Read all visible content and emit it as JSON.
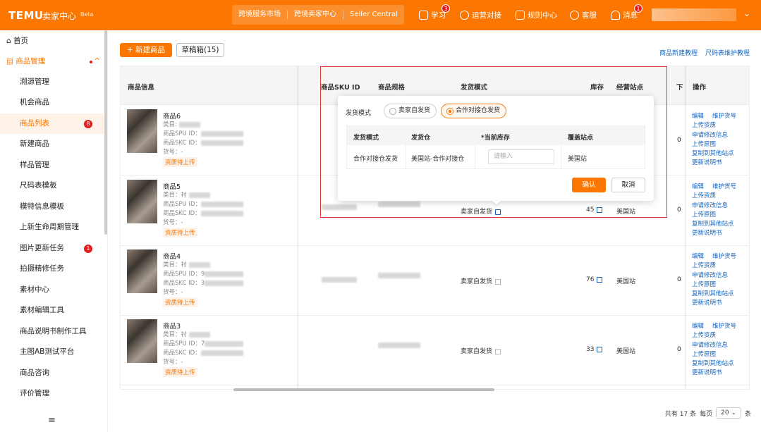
{
  "colors": {
    "brand": "#fb7701",
    "link": "#1565c0",
    "highlight_box": "#e53935",
    "badge": "#e02020"
  },
  "header": {
    "logo": "TEMU",
    "brand_title": "卖家中心",
    "beta": "Beta",
    "nav": [
      "跨境服务市场",
      "跨境卖家中心",
      "Seller Central"
    ],
    "items": [
      {
        "icon": "book-icon",
        "label": "学习",
        "badge": "3"
      },
      {
        "icon": "chat-icon",
        "label": "运营对接"
      },
      {
        "icon": "document-icon",
        "label": "规则中心"
      },
      {
        "icon": "headset-icon",
        "label": "客服"
      },
      {
        "icon": "bell-icon",
        "label": "消息",
        "badge": "1"
      }
    ]
  },
  "sidebar": {
    "items": [
      {
        "label": "首页",
        "icon": "home-icon"
      },
      {
        "label": "商品管理",
        "icon": "box-icon"
      },
      {
        "label": "溯源管理"
      },
      {
        "label": "机会商品"
      },
      {
        "label": "商品列表",
        "badge": "8"
      },
      {
        "label": "新建商品"
      },
      {
        "label": "样品管理"
      },
      {
        "label": "尺码表模板"
      },
      {
        "label": "模特信息模板"
      },
      {
        "label": "上新生命周期管理"
      },
      {
        "label": "图片更新任务",
        "badge": "1"
      },
      {
        "label": "拍摄精修任务"
      },
      {
        "label": "素材中心"
      },
      {
        "label": "素材编辑工具"
      },
      {
        "label": "商品说明书制作工具"
      },
      {
        "label": "主图AB测试平台"
      },
      {
        "label": "商品咨询"
      },
      {
        "label": "评价管理"
      }
    ],
    "collapse_icon": "≡"
  },
  "toolbar": {
    "new_product": "+ 新建商品",
    "drafts": "草稿箱(15)",
    "links": [
      "商品新建教程",
      "尺码表维护教程"
    ]
  },
  "table": {
    "headers": {
      "info": "商品信息",
      "sku": "商品SKU ID",
      "spec": "商品规格",
      "ship": "发货模式",
      "stock": "库存",
      "site": "经营站点",
      "down": "下",
      "ops": "操作"
    },
    "rows": [
      {
        "name": "商品6",
        "cat": "类目:",
        "spu": "商品SPU ID：",
        "skc": "商品SKC ID：",
        "code": "货号：-",
        "tag": "资质待上传",
        "ship": "",
        "stock": "",
        "site": "",
        "zero": "0"
      },
      {
        "name": "商品5",
        "cat": "类目：衬",
        "spu": "商品SPU ID：",
        "skc": "商品SKC ID：",
        "code": "货号：-",
        "tag": "资质待上传",
        "ship": "卖家自发货",
        "stock": "45",
        "site": "美国站",
        "zero": "0"
      },
      {
        "name": "商品4",
        "cat": "类目：衬",
        "spu": "商品SPU ID：9",
        "skc": "商品SKC ID：3",
        "code": "货号：-",
        "tag": "资质待上传",
        "ship": "卖家自发货",
        "stock": "76",
        "site": "美国站",
        "zero": "0"
      },
      {
        "name": "商品3",
        "cat": "类目：衬",
        "spu": "商品SPU ID：7",
        "skc": "商品SKC ID：",
        "code": "货号：-",
        "tag": "资质待上传",
        "ship": "卖家自发货",
        "stock": "33",
        "site": "美国站",
        "zero": "0"
      }
    ],
    "ops": {
      "edit": "编辑",
      "maintain": "维护货号",
      "upload_cert": "上传资质",
      "apply_edit": "申请修改信息",
      "upload_img": "上传原图",
      "copy": "复制到其他站点",
      "manual": "更新说明书"
    }
  },
  "popover": {
    "label": "发货模式",
    "options": [
      "卖家自发货",
      "合作对接仓发货"
    ],
    "selected": "合作对接仓发货",
    "headers": [
      "发货模式",
      "发货仓",
      "*当前库存",
      "覆盖站点"
    ],
    "row": {
      "mode": "合作对接仓发货",
      "warehouse": "美国站-合作对接仓",
      "stock_placeholder": "请输入",
      "site": "美国站"
    },
    "confirm": "确认",
    "cancel": "取消"
  },
  "pager": {
    "total": "共有 17 条",
    "per_page": "每页",
    "size": "20",
    "unit": "条"
  }
}
